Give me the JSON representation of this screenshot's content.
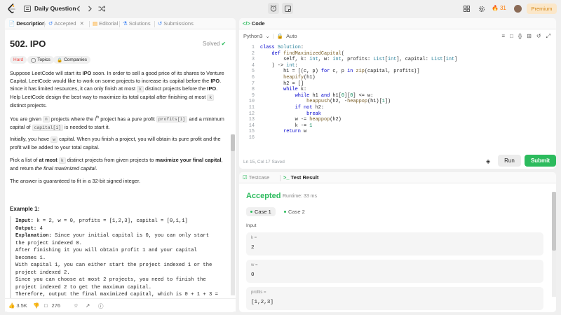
{
  "topbar": {
    "title": "Daily Question",
    "streak_count": "31",
    "premium_label": "Premium"
  },
  "left_tabs": [
    {
      "label": "Description",
      "icon": "document-icon",
      "active": true
    },
    {
      "label": "Accepted",
      "icon": "history-icon",
      "closable": true
    },
    {
      "label": "Editorial",
      "icon": "book-icon"
    },
    {
      "label": "Solutions",
      "icon": "flask-icon"
    },
    {
      "label": "Submissions",
      "icon": "history-icon"
    }
  ],
  "problem": {
    "title": "502. IPO",
    "status": "Solved",
    "difficulty": "Hard",
    "topics_label": "Topics",
    "companies_label": "Companies",
    "colors": {
      "hard": "#ef4743",
      "solved": "#2cbb5d"
    }
  },
  "description": {
    "p1_a": "Suppose LeetCode will start its ",
    "p1_b": "IPO",
    "p1_c": " soon. In order to sell a good price of its shares to Venture Capital, LeetCode would like to work on some projects to increase its capital before the ",
    "p1_d": "IPO",
    "p1_e": ". Since it has limited resources, it can only finish at most ",
    "p1_f": "k",
    "p1_g": " distinct projects before the ",
    "p1_h": "IPO",
    "p1_i": ". Help LeetCode design the best way to maximize its total capital after finishing at most ",
    "p1_j": "k",
    "p1_k": " distinct projects.",
    "p2_a": "You are given ",
    "p2_b": "n",
    "p2_c": " projects where the i",
    "p2_d": "th",
    "p2_e": " project has a pure profit ",
    "p2_f": "profits[i]",
    "p2_g": " and a minimum capital of ",
    "p2_h": "capital[i]",
    "p2_i": " is needed to start it.",
    "p3_a": "Initially, you have ",
    "p3_b": "w",
    "p3_c": " capital. When you finish a project, you will obtain its pure profit and the profit will be added to your total capital.",
    "p4_a": "Pick a list of ",
    "p4_b": "at most",
    "p4_c": "k",
    "p4_d": " distinct projects from given projects to ",
    "p4_e": "maximize your final capital",
    "p4_f": ", and return ",
    "p4_g": "the final maximized capital",
    "p4_h": ".",
    "p5": "The answer is guaranteed to fit in a 32-bit signed integer."
  },
  "example": {
    "title": "Example 1:",
    "input_label": "Input:",
    "input_value": " k = 2, w = 0, profits = [1,2,3], capital = [0,1,1]",
    "output_label": "Output:",
    "output_value": " 4",
    "explanation_label": "Explanation:",
    "explanation_lines": [
      " Since your initial capital is 0, you can only start",
      "the project indexed 0.",
      "After finishing it you will obtain profit 1 and your capital",
      "becomes 1.",
      "With capital 1, you can either start the project indexed 1 or the",
      "project indexed 2.",
      "Since you can choose at most 2 projects, you need to finish the",
      "project indexed 2 to get the maximum capital.",
      "Therefore, output the final maximized capital, which is 0 + 1 + 3 ="
    ]
  },
  "bottombar": {
    "likes": "3.5K",
    "comments": "276"
  },
  "code_panel": {
    "title": "Code",
    "language": "Python3",
    "mode": "Auto",
    "status": "Ln 15, Col 17    Saved",
    "run_label": "Run",
    "submit_label": "Submit",
    "line_numbers": [
      "1",
      "2",
      "3",
      "4",
      "5",
      "6",
      "7",
      "8",
      "9",
      "10",
      "11",
      "12",
      "13",
      "14",
      "15",
      "16"
    ]
  },
  "result_panel": {
    "testcase_tab": "Testcase",
    "result_tab": "Test Result",
    "verdict": "Accepted",
    "runtime": "Runtime: 33 ms",
    "cases": [
      "Case 1",
      "Case 2"
    ],
    "input_label": "Input",
    "vars": [
      {
        "name": "k =",
        "value": "2"
      },
      {
        "name": "w =",
        "value": "0"
      },
      {
        "name": "profits =",
        "value": "[1,2,3]"
      }
    ]
  }
}
